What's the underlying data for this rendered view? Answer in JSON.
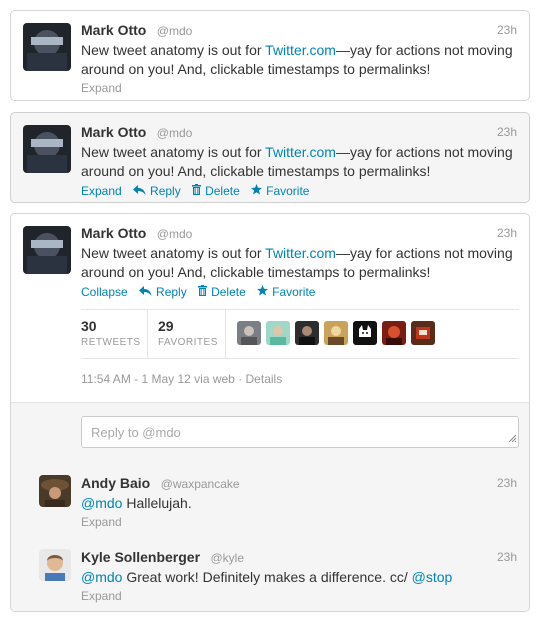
{
  "tweets": [
    {
      "name": "Mark Otto",
      "handle": "@mdo",
      "time": "23h",
      "text_before": "New tweet anatomy is out for ",
      "link": "Twitter.com",
      "text_after": "—yay for actions not moving around on you! And, clickable timestamps to permalinks!",
      "expand": "Expand"
    },
    {
      "name": "Mark Otto",
      "handle": "@mdo",
      "time": "23h",
      "text_before": "New tweet anatomy is out for ",
      "link": "Twitter.com",
      "text_after": "—yay for actions not moving around on you! And, clickable timestamps to permalinks!",
      "actions": {
        "expand": "Expand",
        "reply": "Reply",
        "delete": "Delete",
        "favorite": "Favorite"
      }
    },
    {
      "name": "Mark Otto",
      "handle": "@mdo",
      "time": "23h",
      "text_before": "New tweet anatomy is out for ",
      "link": "Twitter.com",
      "text_after": "—yay for actions not moving around on you! And, clickable timestamps to permalinks!",
      "actions": {
        "collapse": "Collapse",
        "reply": "Reply",
        "delete": "Delete",
        "favorite": "Favorite"
      },
      "stats": {
        "retweets": "30",
        "retweets_label": "RETWEETS",
        "favorites": "29",
        "favorites_label": "FAVORITES"
      },
      "meta": "11:54 AM - 1 May 12 via web · Details",
      "reply_placeholder": "Reply to @mdo"
    }
  ],
  "replies": [
    {
      "name": "Andy Baio",
      "handle": "@waxpancake",
      "time": "23h",
      "mention": "@mdo",
      "text": " Hallelujah.",
      "expand": "Expand"
    },
    {
      "name": "Kyle Sollenberger",
      "handle": "@kyle",
      "time": "23h",
      "mention": "@mdo",
      "text": " Great work! Definitely makes a difference. cc/ ",
      "mention2": "@stop",
      "expand": "Expand"
    }
  ],
  "colors": {
    "link": "#0084b4",
    "muted": "#999999",
    "text": "#333333",
    "hover_bg": "#f5f5f5",
    "border": "#d6d6d6"
  },
  "icons": [
    "reply-icon",
    "trash-icon",
    "star-icon",
    "resize-grip-icon"
  ]
}
